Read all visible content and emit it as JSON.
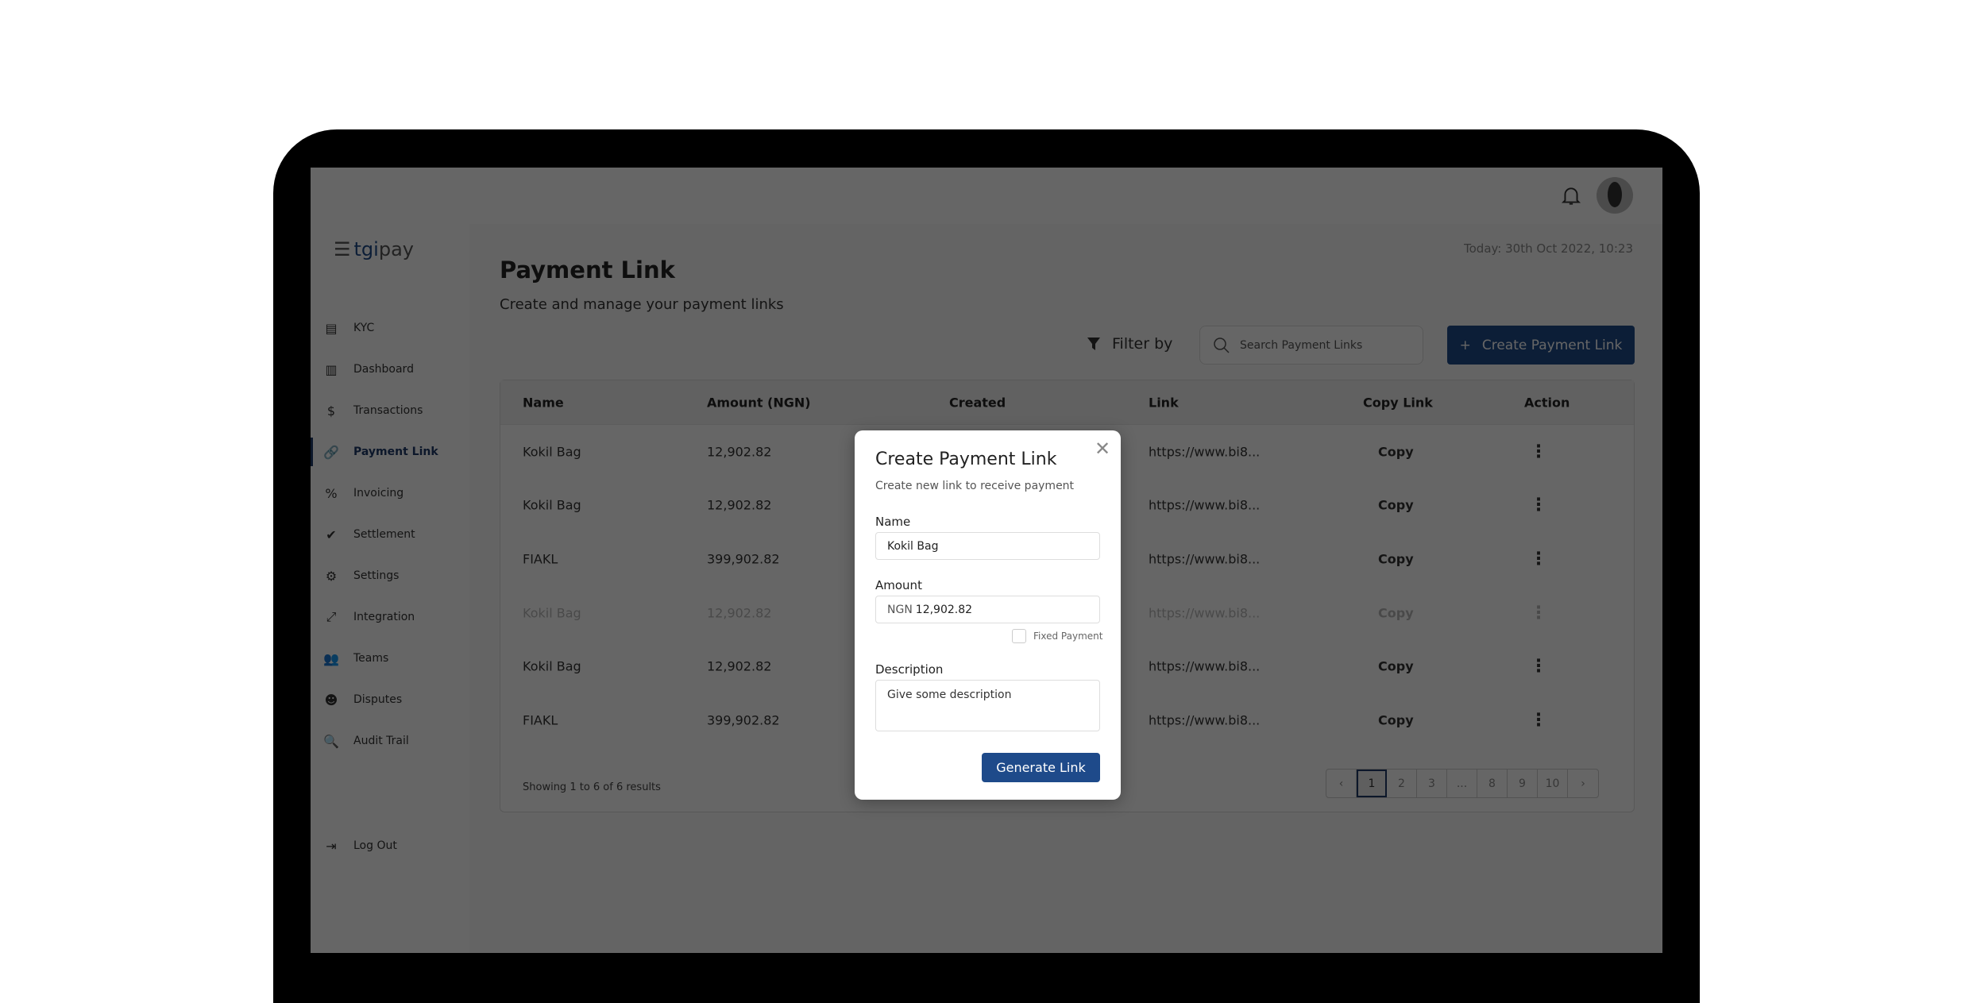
{
  "brand": {
    "logo_prefix": "tgi",
    "logo_suffix": "pay",
    "accent": "#1e4a8a"
  },
  "sidebar": {
    "items": [
      {
        "label": "KYC",
        "icon": "id-card-icon",
        "glyph": "▤"
      },
      {
        "label": "Dashboard",
        "icon": "bar-chart-icon",
        "glyph": "▥"
      },
      {
        "label": "Transactions",
        "icon": "dollar-circle-icon",
        "glyph": "$"
      },
      {
        "label": "Payment Link",
        "icon": "link-icon",
        "glyph": "🔗",
        "active": true
      },
      {
        "label": "Invoicing",
        "icon": "invoice-percent-icon",
        "glyph": "%"
      },
      {
        "label": "Settlement",
        "icon": "clipboard-check-icon",
        "glyph": "✔"
      },
      {
        "label": "Settings",
        "icon": "gear-icon",
        "glyph": "⚙"
      },
      {
        "label": "Integration",
        "icon": "expand-arrows-icon",
        "glyph": "⤢"
      },
      {
        "label": "Teams",
        "icon": "team-icon",
        "glyph": "👥"
      },
      {
        "label": "Disputes",
        "icon": "face-icon",
        "glyph": "☻"
      },
      {
        "label": "Audit Trail",
        "icon": "file-search-icon",
        "glyph": "🔍"
      }
    ],
    "logout": {
      "label": "Log Out",
      "glyph": "⇥"
    }
  },
  "page": {
    "title": "Payment Link",
    "subtitle": "Create and manage your payment links",
    "today": "Today: 30th Oct 2022, 10:23"
  },
  "toolbar": {
    "filter_label": "Filter by",
    "search_placeholder": "Search Payment Links",
    "create_label": "Create Payment Link"
  },
  "table": {
    "columns": [
      "Name",
      "Amount (NGN)",
      "Created",
      "Link",
      "Copy Link",
      "Action"
    ],
    "rows": [
      {
        "name": "Kokil Bag",
        "amount": "12,902.82",
        "link": "https://www.bi8...",
        "copy": "Copy"
      },
      {
        "name": "Kokil Bag",
        "amount": "12,902.82",
        "link": "https://www.bi8...",
        "copy": "Copy"
      },
      {
        "name": "FIAKL",
        "amount": "399,902.82",
        "link": "https://www.bi8...",
        "copy": "Copy"
      },
      {
        "name": "Kokil Bag",
        "amount": "12,902.82",
        "link": "https://www.bi8...",
        "copy": "Copy"
      },
      {
        "name": "Kokil Bag",
        "amount": "12,902.82",
        "link": "https://www.bi8...",
        "copy": "Copy"
      },
      {
        "name": "FIAKL",
        "amount": "399,902.82",
        "link": "https://www.bi8...",
        "copy": "Copy"
      }
    ],
    "showing": "Showing 1 to 6 of 6 results",
    "pages": [
      "‹",
      "1",
      "2",
      "3",
      "...",
      "8",
      "9",
      "10",
      "›"
    ],
    "current_page": "1"
  },
  "modal": {
    "title": "Create Payment Link",
    "subtitle": "Create new link to receive payment",
    "name_label": "Name",
    "name_value": "Kokil Bag",
    "amount_label": "Amount",
    "amount_currency": "NGN",
    "amount_value": "12,902.82",
    "fixed_label": "Fixed Payment",
    "fixed_checked": false,
    "description_label": "Description",
    "description_placeholder": "Give some description",
    "submit_label": "Generate Link"
  }
}
